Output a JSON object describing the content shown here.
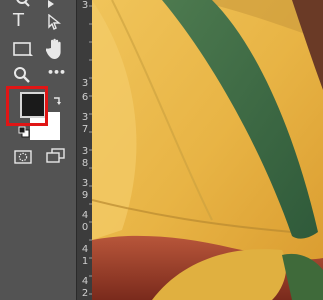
{
  "toolbar": {
    "tools": [
      {
        "name": "zoom-partial-icon"
      },
      {
        "name": "type-tool-icon",
        "glyph": "T"
      },
      {
        "name": "path-selection-icon"
      },
      {
        "name": "rectangle-tool-icon"
      },
      {
        "name": "hand-tool-icon"
      },
      {
        "name": "zoom-tool-icon"
      },
      {
        "name": "more-tools-icon",
        "glyph": "•••"
      },
      {
        "name": "quick-mask-icon"
      },
      {
        "name": "screen-mode-icon"
      }
    ],
    "foreground_color": "#1a1a1a",
    "background_color": "#ffffff",
    "highlight_color": "#e01515"
  },
  "ruler": {
    "labels": [
      "3",
      "3",
      "6",
      "3",
      "7",
      "3",
      "8",
      "3",
      "9",
      "4",
      "0",
      "4",
      "1",
      "4",
      "2"
    ]
  },
  "colors": {
    "toolbar_bg": "#535353",
    "ruler_bg": "#3c3c3c"
  }
}
